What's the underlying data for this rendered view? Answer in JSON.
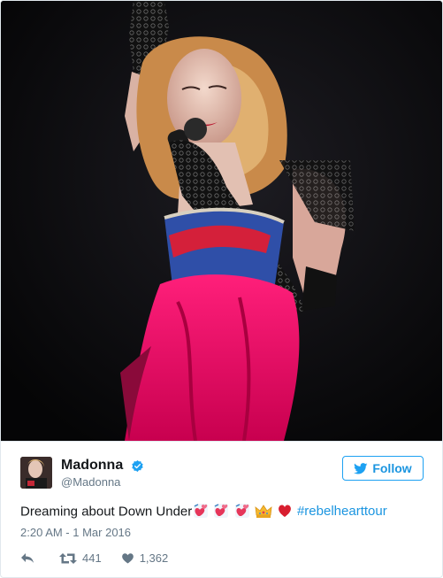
{
  "tweet": {
    "user": {
      "display_name": "Madonna",
      "handle": "@Madonna",
      "verified_icon": "verified-badge-icon"
    },
    "follow_label": "Follow",
    "text": "Dreaming about Down Under",
    "emojis": [
      "revolving-hearts",
      "revolving-hearts",
      "revolving-hearts",
      "crown",
      "red-heart"
    ],
    "hashtag": "#rebelhearttour",
    "timestamp": "2:20 AM - 1 Mar 2016",
    "retweet_count": "441",
    "like_count": "1,362"
  },
  "colors": {
    "brand_blue": "#1da1f2",
    "link_blue": "#1b95e0",
    "text": "#14171a",
    "secondary": "#657786"
  }
}
